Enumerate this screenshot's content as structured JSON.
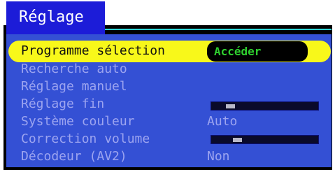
{
  "menu": {
    "title": "Réglage",
    "selected": {
      "label": "Programme sélection",
      "value": "Accéder"
    },
    "items": [
      {
        "label": "Recherche auto",
        "value": ""
      },
      {
        "label": "Réglage manuel",
        "value": ""
      },
      {
        "label": "Réglage fin",
        "value": "",
        "slider_level": 0.15
      },
      {
        "label": "Système couleur",
        "value": "Auto"
      },
      {
        "label": "Correction volume",
        "value": "",
        "slider_level": 0.22
      },
      {
        "label": "Décodeur (AV2)",
        "value": "Non"
      }
    ]
  },
  "colors": {
    "panel": "#3450d4",
    "tab": "#1c1cd8",
    "highlight": "#f8f81a",
    "text": "#9ca4f0",
    "selected_value": "#2fd02f"
  }
}
